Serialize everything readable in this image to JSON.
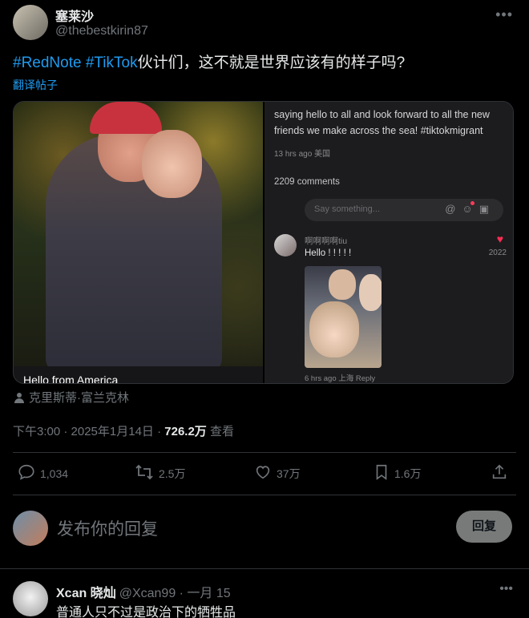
{
  "author": {
    "name": "塞莱沙",
    "handle": "@thebestkirin87"
  },
  "tweet": {
    "hashtag1": "#RedNote",
    "hashtag2": "#TikTok",
    "text": "伙计们，这不就是世界应该有的样子吗?",
    "translate_label": "翻译帖子"
  },
  "media": {
    "photo_caption": "Hello from America",
    "comment_panel": {
      "post_text": "saying hello to all and look forward to all the new friends we make across the sea!  #tiktokmigrant",
      "post_meta": "13 hrs ago 美国",
      "comment_count": "2209 comments",
      "input_placeholder": "Say something...",
      "comment": {
        "user": "啊啊啊啊tiu",
        "text": "Hello ! ! ! ! !",
        "likes": "2022",
        "meta": "6 hrs ago 上海 Reply"
      }
    }
  },
  "credit": "克里斯蒂·富兰克林",
  "meta": {
    "time": "下午3:00 · 2025年1月14日 · ",
    "views": "726.2万",
    "views_label": " 查看"
  },
  "actions": {
    "replies": "1,034",
    "retweets": "2.5万",
    "likes": "37万",
    "bookmarks": "1.6万"
  },
  "composer": {
    "placeholder": "发布你的回复",
    "button": "回复"
  },
  "reply": {
    "name": "Xcan 晓灿",
    "handle": "@Xcan99 · 一月 15",
    "text": "普通人只不过是政治下的牺牲品"
  },
  "icons": [
    "more-icon",
    "person-icon",
    "reply-icon",
    "retweet-icon",
    "like-icon",
    "bookmark-icon",
    "share-icon"
  ]
}
